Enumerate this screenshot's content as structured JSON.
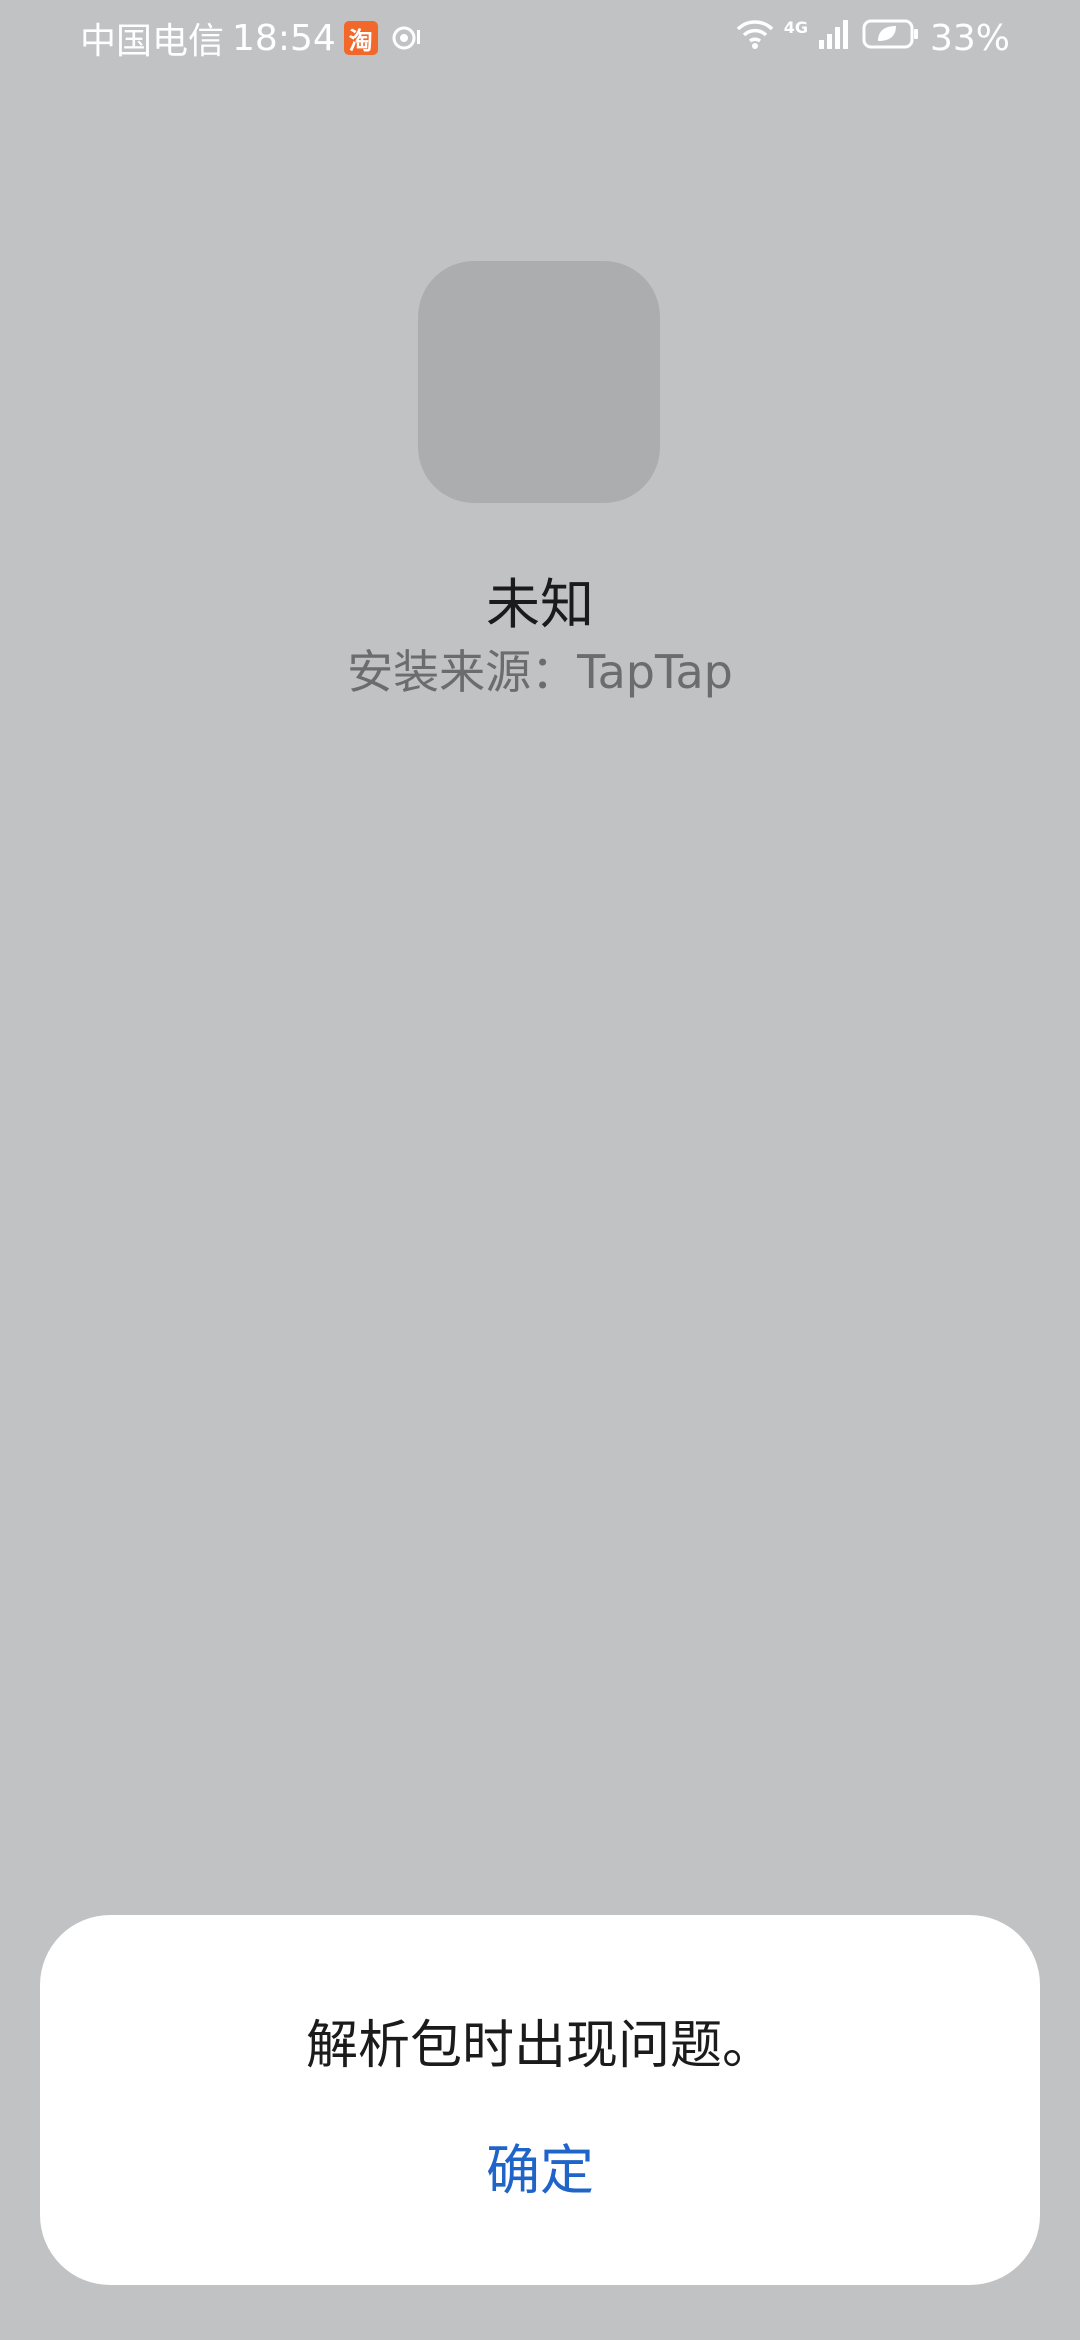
{
  "status_bar": {
    "carrier": "中国电信",
    "time": "18:54",
    "taobao_icon_text": "淘",
    "network_type": "4G",
    "battery_percent": "33%"
  },
  "app": {
    "name": "未知",
    "install_source": "安装来源：TapTap"
  },
  "dialog": {
    "message": "解析包时出现问题。",
    "confirm_label": "确定"
  },
  "colors": {
    "background": "#c1c2c4",
    "dialog_background": "#ffffff",
    "accent": "#1f64c8",
    "taobao_orange": "#f2672a"
  }
}
